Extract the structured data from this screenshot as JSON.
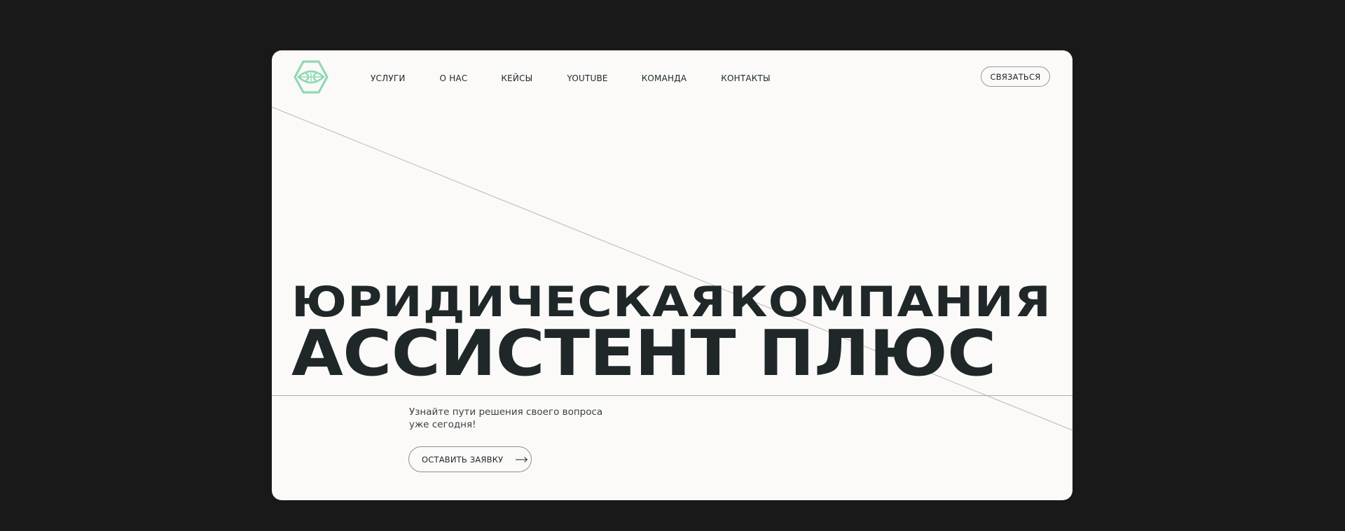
{
  "colors": {
    "page_background": "#191919",
    "card_background": "#fbfaf8",
    "text_dark": "#1f2729",
    "logo_accent": "#8fd9b6",
    "line_gray": "#a9a9a9"
  },
  "header": {
    "logo_icon": "hexagon-eye-logo-icon",
    "nav": [
      {
        "label": "УСЛУГИ"
      },
      {
        "label": "О НАС"
      },
      {
        "label": "КЕЙСЫ"
      },
      {
        "label": "YOUTUBE"
      },
      {
        "label": "КОМАНДА"
      },
      {
        "label": "КОНТАКТЫ"
      }
    ],
    "contact_button_label": "СВЯЗАТЬСЯ"
  },
  "hero": {
    "headline_word_1": "ЮРИДИЧЕСКАЯ",
    "headline_word_2": "КОМПАНИЯ",
    "headline_main": "АССИСТЕНТ ПЛЮС",
    "subtitle_line_1": "Узнайте пути решения своего вопроса",
    "subtitle_line_2": "уже сегодня!",
    "cta_label": "ОСТАВИТЬ ЗАЯВКУ",
    "cta_icon": "arrow-right-icon"
  }
}
